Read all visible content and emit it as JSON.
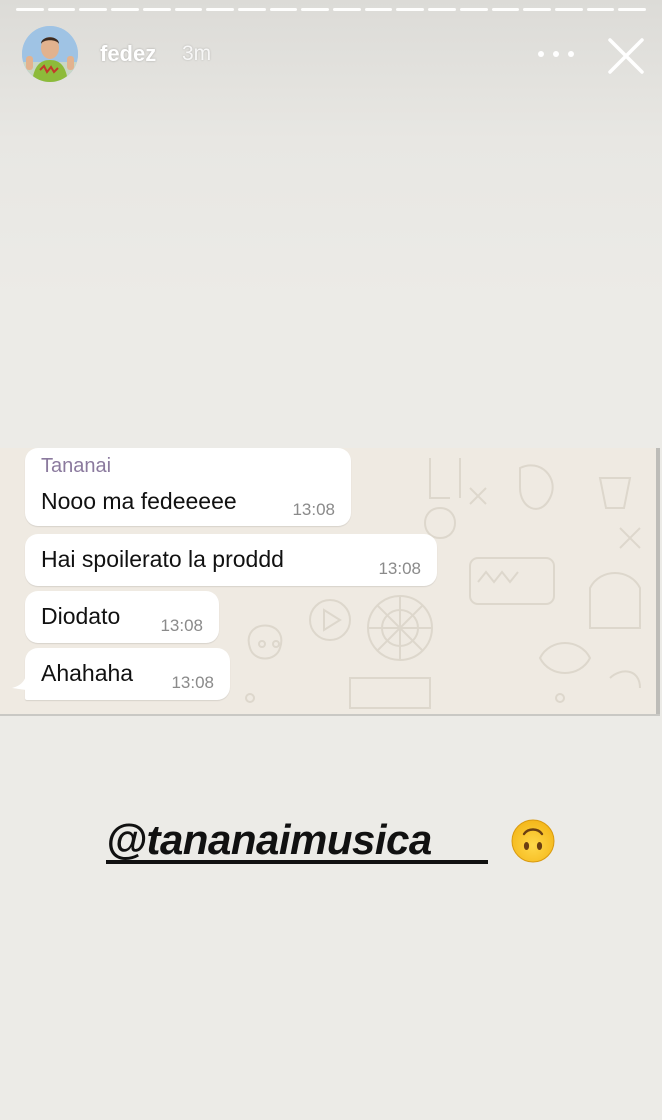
{
  "story": {
    "progress_segments": 20,
    "username": "fedez",
    "time_ago": "3m",
    "more_icon": "more-horizontal-icon",
    "close_icon": "close-icon"
  },
  "chat": {
    "background_color": "#efeae2",
    "messages": [
      {
        "sender": "Tananai",
        "text": "Nooo ma fedeeeee",
        "time": "13:08"
      },
      {
        "text": "Hai spoilerato la proddd",
        "time": "13:08"
      },
      {
        "text": "Diodato",
        "time": "13:08"
      },
      {
        "text": "Ahahaha",
        "time": "13:08"
      }
    ]
  },
  "sticker": {
    "mention": "@tananaimusica",
    "emoji": "upside-down-face-emoji"
  }
}
